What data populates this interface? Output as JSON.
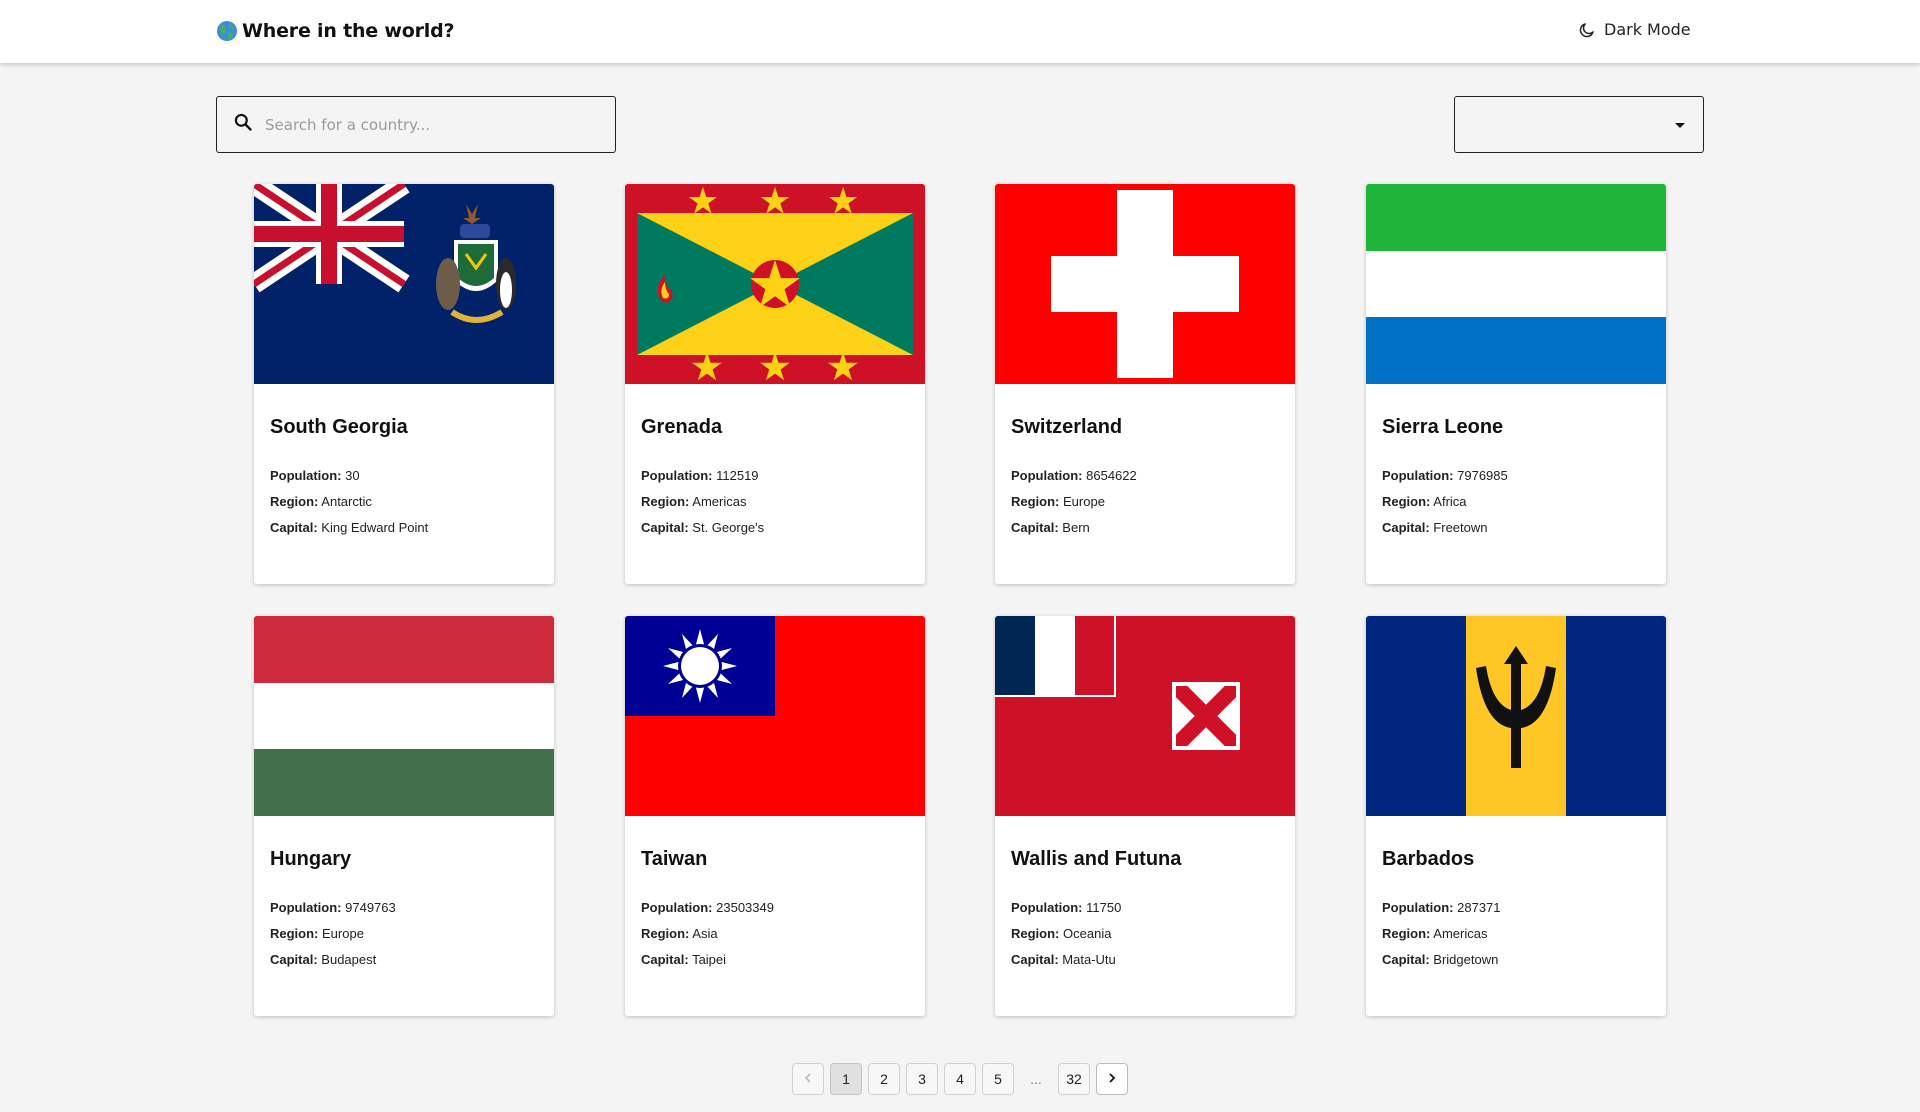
{
  "header": {
    "globe_icon": "globe-icon",
    "title": "Where in the world?",
    "dark_mode_icon": "moon-icon",
    "dark_mode_label": "Dark Mode"
  },
  "search": {
    "icon": "search-icon",
    "placeholder": "Search for a country...",
    "value": ""
  },
  "region_filter": {
    "value": "",
    "icon": "caret-down-icon"
  },
  "labels": {
    "population": "Population:",
    "region": "Region:",
    "capital": "Capital:"
  },
  "countries": [
    {
      "name": "South Georgia",
      "population": "30",
      "region": "Antarctic",
      "capital": "King Edward Point",
      "flag": "south-georgia-flag"
    },
    {
      "name": "Grenada",
      "population": "112519",
      "region": "Americas",
      "capital": "St. George's",
      "flag": "grenada-flag"
    },
    {
      "name": "Switzerland",
      "population": "8654622",
      "region": "Europe",
      "capital": "Bern",
      "flag": "switzerland-flag"
    },
    {
      "name": "Sierra Leone",
      "population": "7976985",
      "region": "Africa",
      "capital": "Freetown",
      "flag": "sierra-leone-flag"
    },
    {
      "name": "Hungary",
      "population": "9749763",
      "region": "Europe",
      "capital": "Budapest",
      "flag": "hungary-flag"
    },
    {
      "name": "Taiwan",
      "population": "23503349",
      "region": "Asia",
      "capital": "Taipei",
      "flag": "taiwan-flag"
    },
    {
      "name": "Wallis and Futuna",
      "population": "11750",
      "region": "Oceania",
      "capital": "Mata-Utu",
      "flag": "wallis-and-futuna-flag"
    },
    {
      "name": "Barbados",
      "population": "287371",
      "region": "Americas",
      "capital": "Bridgetown",
      "flag": "barbados-flag"
    }
  ],
  "pagination": {
    "prev_icon": "chevron-left-icon",
    "next_icon": "chevron-right-icon",
    "current": "1",
    "pages": [
      "1",
      "2",
      "3",
      "4",
      "5"
    ],
    "ellipsis": "...",
    "last": "32"
  },
  "colors": {
    "background": "#f4f4f4",
    "card": "#ffffff",
    "text": "#111111"
  }
}
